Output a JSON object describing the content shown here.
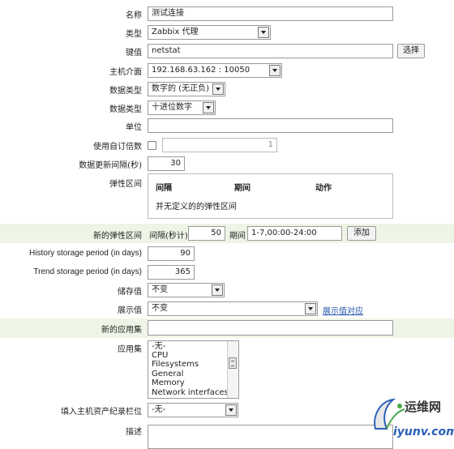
{
  "form": {
    "name": {
      "label": "名称",
      "value": "测试连接"
    },
    "type": {
      "label": "类型",
      "value": "Zabbix 代理"
    },
    "key": {
      "label": "键值",
      "value": "netstat",
      "button": "选择"
    },
    "interface": {
      "label": "主机介面",
      "value": "192.168.63.162 : 10050"
    },
    "info_type": {
      "label": "数据类型",
      "value": "数字的 (无正负)"
    },
    "data_type": {
      "label": "数据类型",
      "value": "十进位数字"
    },
    "units": {
      "label": "单位",
      "value": ""
    },
    "multiplier": {
      "label": "使用自订倍数",
      "checked": false,
      "value": "1"
    },
    "update_interval": {
      "label": "数据更新间隔(秒)",
      "value": "30"
    },
    "flex": {
      "label": "弹性区间",
      "columns": [
        "间隔",
        "期间",
        "动作"
      ],
      "empty_text": "并无定义的的弹性区间"
    },
    "new_flex": {
      "label": "新的弹性区间",
      "interval_label": "间隔(秒计)",
      "interval_value": "50",
      "period_label": "期间",
      "period_value": "1-7,00:00-24:00",
      "add_button": "添加"
    },
    "history": {
      "label": "History storage period (in days)",
      "value": "90"
    },
    "trend": {
      "label": "Trend storage period (in days)",
      "value": "365"
    },
    "store_value": {
      "label": "储存值",
      "value": "不变"
    },
    "show_value": {
      "label": "展示值",
      "value": "不变",
      "link": "展示值对应"
    },
    "new_application": {
      "label": "新的应用集",
      "value": ""
    },
    "applications": {
      "label": "应用集",
      "items": [
        "-无-",
        "CPU",
        "Filesystems",
        "General",
        "Memory",
        "Network interfaces"
      ]
    },
    "inventory": {
      "label": "填入主机资产纪录栏位",
      "value": "-无-"
    },
    "description": {
      "label": "描述",
      "value": ""
    }
  },
  "watermark": {
    "brand": "运维网",
    "domain": "iyunv.com"
  }
}
